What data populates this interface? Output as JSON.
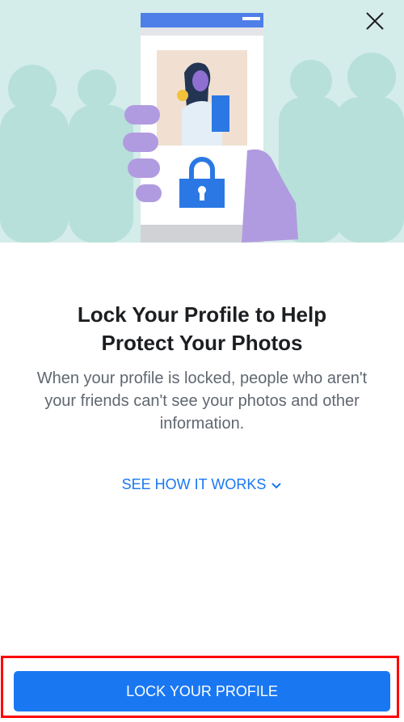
{
  "modal": {
    "title_line1": "Lock Your Profile to Help",
    "title_line2": "Protect Your Photos",
    "description": "When your profile is locked, people who aren't your friends can't see your photos and other information.",
    "see_how_link": "SEE HOW IT WORKS",
    "primary_button": "LOCK YOUR PROFILE"
  },
  "icons": {
    "close": "close-icon",
    "chevron": "chevron-down-icon",
    "lock": "lock-icon"
  },
  "colors": {
    "accent": "#1877f2",
    "button": "#1a77f2",
    "hero_background": "#d4ecea",
    "highlight_frame": "#ff0000"
  }
}
